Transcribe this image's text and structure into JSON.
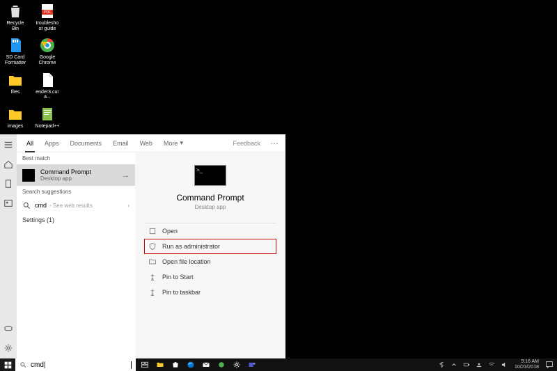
{
  "desktop": {
    "icons": [
      {
        "label": "Recycle Bin"
      },
      {
        "label": "troubleshoot guide"
      },
      {
        "label": "SD Card Formatter"
      },
      {
        "label": "Google Chrome"
      },
      {
        "label": "files"
      },
      {
        "label": "ender3.cura..."
      },
      {
        "label": "images"
      },
      {
        "label": "Notepad++"
      }
    ]
  },
  "search": {
    "tabs": {
      "all": "All",
      "apps": "Apps",
      "documents": "Documents",
      "email": "Email",
      "web": "Web",
      "more": "More"
    },
    "feedback": "Feedback",
    "best_match_label": "Best match",
    "best_match": {
      "title": "Command Prompt",
      "subtitle": "Desktop app"
    },
    "suggestions_label": "Search suggestions",
    "suggestion": {
      "query": "cmd",
      "hint": "- See web results"
    },
    "settings_label": "Settings (1)",
    "detail": {
      "title": "Command Prompt",
      "subtitle": "Desktop app",
      "actions": {
        "open": "Open",
        "run_admin": "Run as administrator",
        "open_loc": "Open file location",
        "pin_start": "Pin to Start",
        "pin_taskbar": "Pin to taskbar"
      }
    },
    "input_value": "cmd"
  },
  "taskbar": {
    "time": "9:16 AM",
    "date": "10/23/2018"
  }
}
